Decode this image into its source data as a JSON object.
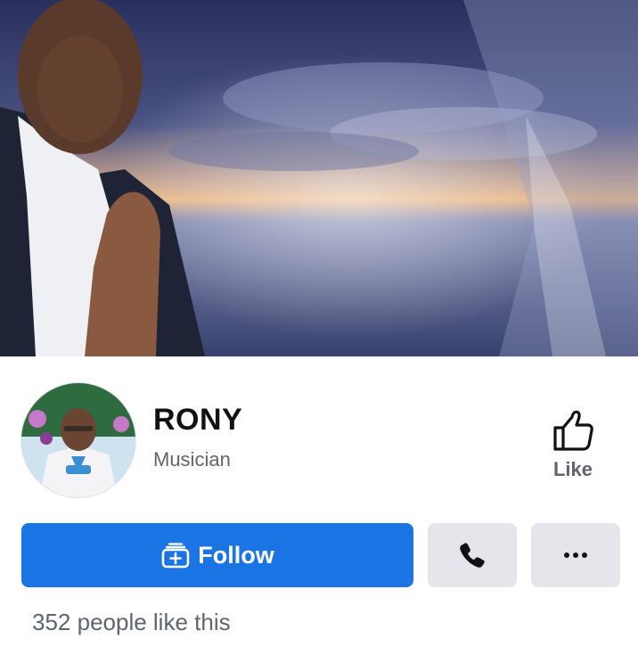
{
  "page": {
    "name": "RONY",
    "category": "Musician"
  },
  "actions": {
    "like_label": "Like",
    "follow_label": "Follow"
  },
  "stats": {
    "likes_text": "352 people like this"
  },
  "icons": {
    "like": "thumbs-up-icon",
    "follow": "follow-add-icon",
    "call": "phone-icon",
    "more": "more-dots-icon"
  },
  "colors": {
    "accent": "#1b74e4",
    "secondary_button": "#e4e6eb",
    "muted_text": "#5e6470"
  }
}
